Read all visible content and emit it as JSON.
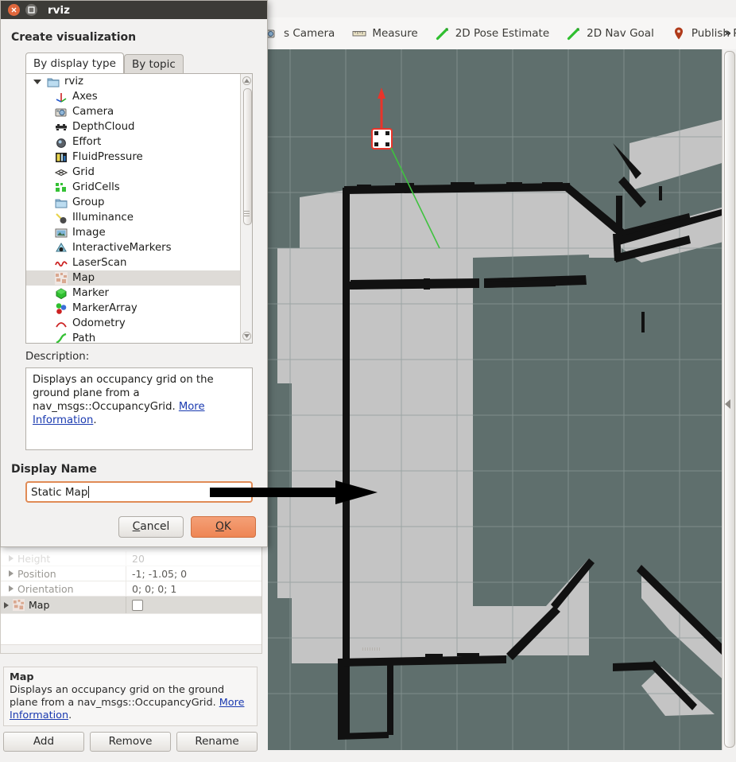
{
  "window": {
    "title": "rviz"
  },
  "toolbar": {
    "items": [
      {
        "label": "s Camera",
        "icon": "camera-icon"
      },
      {
        "label": "Measure",
        "icon": "ruler-icon"
      },
      {
        "label": "2D Pose Estimate",
        "icon": "pose-arrow-icon"
      },
      {
        "label": "2D Nav Goal",
        "icon": "nav-goal-arrow-icon"
      },
      {
        "label": "Publish Point",
        "icon": "map-pin-icon"
      },
      {
        "label": "",
        "icon": "plus-icon"
      }
    ],
    "overflow": "»"
  },
  "dialog": {
    "heading": "Create visualization",
    "tabs": [
      {
        "label": "By display type",
        "active": true
      },
      {
        "label": "By topic",
        "active": false
      }
    ],
    "tree": {
      "root": {
        "label": "rviz",
        "icon": "folder-icon",
        "expanded": true
      },
      "items": [
        {
          "label": "Axes",
          "icon": "axes-icon",
          "selected": false
        },
        {
          "label": "Camera",
          "icon": "camera-icon",
          "selected": false
        },
        {
          "label": "DepthCloud",
          "icon": "depthcloud-icon",
          "selected": false
        },
        {
          "label": "Effort",
          "icon": "effort-icon",
          "selected": false
        },
        {
          "label": "FluidPressure",
          "icon": "fluidpressure-icon",
          "selected": false
        },
        {
          "label": "Grid",
          "icon": "grid-icon",
          "selected": false
        },
        {
          "label": "GridCells",
          "icon": "gridcells-icon",
          "selected": false
        },
        {
          "label": "Group",
          "icon": "folder-icon",
          "selected": false
        },
        {
          "label": "Illuminance",
          "icon": "illuminance-icon",
          "selected": false
        },
        {
          "label": "Image",
          "icon": "image-icon",
          "selected": false
        },
        {
          "label": "InteractiveMarkers",
          "icon": "interactive-markers-icon",
          "selected": false
        },
        {
          "label": "LaserScan",
          "icon": "laserscan-icon",
          "selected": false
        },
        {
          "label": "Map",
          "icon": "map-icon",
          "selected": true
        },
        {
          "label": "Marker",
          "icon": "marker-icon",
          "selected": false
        },
        {
          "label": "MarkerArray",
          "icon": "markerarray-icon",
          "selected": false
        },
        {
          "label": "Odometry",
          "icon": "odometry-icon",
          "selected": false
        },
        {
          "label": "Path",
          "icon": "path-icon",
          "selected": false
        }
      ]
    },
    "description": {
      "label": "Description:",
      "text_before_link": "Displays an occupancy grid on the ground plane from a nav_msgs::OccupancyGrid. ",
      "link": "More Information",
      "text_after_link": "."
    },
    "display_name": {
      "label": "Display Name",
      "value": "Static Map"
    },
    "buttons": {
      "cancel": {
        "accel": "C",
        "rest": "ancel"
      },
      "ok": {
        "accel": "O",
        "rest": "K"
      }
    }
  },
  "properties_panel": {
    "rows": [
      {
        "name": "Height",
        "value": "20",
        "caret": true,
        "selected": false,
        "icon": "",
        "checkbox": false
      },
      {
        "name": "Position",
        "value": "-1; -1.05; 0",
        "caret": true,
        "selected": false,
        "icon": "",
        "checkbox": false
      },
      {
        "name": "Orientation",
        "value": "0; 0; 0; 1",
        "caret": true,
        "selected": false,
        "icon": "",
        "checkbox": false
      },
      {
        "name": "Map",
        "value": "",
        "caret": true,
        "selected": true,
        "icon": "map-icon",
        "checkbox": true
      }
    ]
  },
  "help_panel": {
    "title": "Map",
    "text_before_link": "Displays an occupancy grid on the ground plane from a nav_msgs::OccupancyGrid. ",
    "link": "More Information",
    "text_after_link": "."
  },
  "bottom_buttons": [
    {
      "label": "Add"
    },
    {
      "label": "Remove"
    },
    {
      "label": "Rename"
    }
  ],
  "viewport": {
    "background_color": "#5f6f6d",
    "free_space_color": "#c4c4c4",
    "wall_color": "#111111",
    "grid_color": "#8c9a98",
    "robot_marker_color": "#e8342a",
    "path_color": "#3fc23f"
  },
  "annotation": {
    "type": "arrow",
    "color": "#000000",
    "points_to": "display-name-input"
  }
}
